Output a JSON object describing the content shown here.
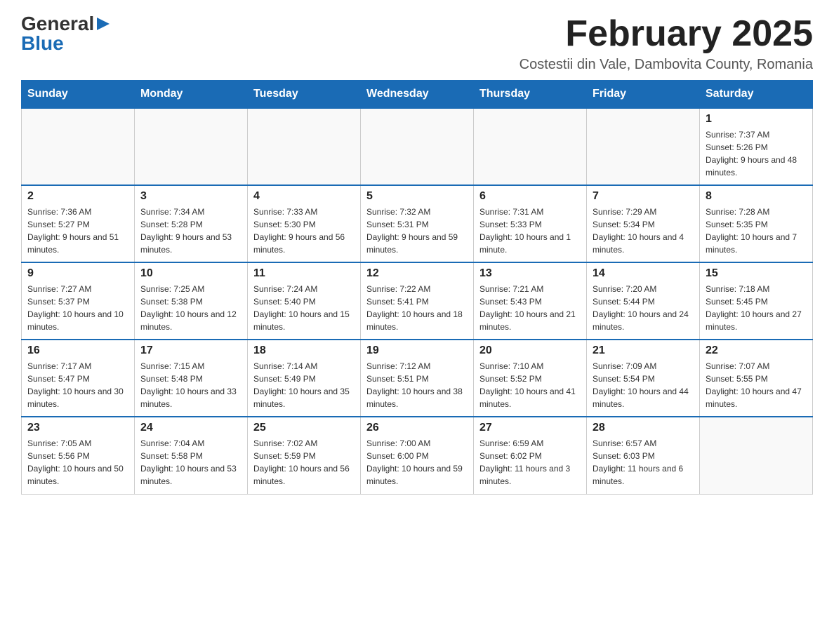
{
  "logo": {
    "general": "General",
    "blue": "Blue"
  },
  "header": {
    "title": "February 2025",
    "subtitle": "Costestii din Vale, Dambovita County, Romania"
  },
  "days_of_week": [
    "Sunday",
    "Monday",
    "Tuesday",
    "Wednesday",
    "Thursday",
    "Friday",
    "Saturday"
  ],
  "weeks": [
    [
      {
        "day": "",
        "info": ""
      },
      {
        "day": "",
        "info": ""
      },
      {
        "day": "",
        "info": ""
      },
      {
        "day": "",
        "info": ""
      },
      {
        "day": "",
        "info": ""
      },
      {
        "day": "",
        "info": ""
      },
      {
        "day": "1",
        "info": "Sunrise: 7:37 AM\nSunset: 5:26 PM\nDaylight: 9 hours and 48 minutes."
      }
    ],
    [
      {
        "day": "2",
        "info": "Sunrise: 7:36 AM\nSunset: 5:27 PM\nDaylight: 9 hours and 51 minutes."
      },
      {
        "day": "3",
        "info": "Sunrise: 7:34 AM\nSunset: 5:28 PM\nDaylight: 9 hours and 53 minutes."
      },
      {
        "day": "4",
        "info": "Sunrise: 7:33 AM\nSunset: 5:30 PM\nDaylight: 9 hours and 56 minutes."
      },
      {
        "day": "5",
        "info": "Sunrise: 7:32 AM\nSunset: 5:31 PM\nDaylight: 9 hours and 59 minutes."
      },
      {
        "day": "6",
        "info": "Sunrise: 7:31 AM\nSunset: 5:33 PM\nDaylight: 10 hours and 1 minute."
      },
      {
        "day": "7",
        "info": "Sunrise: 7:29 AM\nSunset: 5:34 PM\nDaylight: 10 hours and 4 minutes."
      },
      {
        "day": "8",
        "info": "Sunrise: 7:28 AM\nSunset: 5:35 PM\nDaylight: 10 hours and 7 minutes."
      }
    ],
    [
      {
        "day": "9",
        "info": "Sunrise: 7:27 AM\nSunset: 5:37 PM\nDaylight: 10 hours and 10 minutes."
      },
      {
        "day": "10",
        "info": "Sunrise: 7:25 AM\nSunset: 5:38 PM\nDaylight: 10 hours and 12 minutes."
      },
      {
        "day": "11",
        "info": "Sunrise: 7:24 AM\nSunset: 5:40 PM\nDaylight: 10 hours and 15 minutes."
      },
      {
        "day": "12",
        "info": "Sunrise: 7:22 AM\nSunset: 5:41 PM\nDaylight: 10 hours and 18 minutes."
      },
      {
        "day": "13",
        "info": "Sunrise: 7:21 AM\nSunset: 5:43 PM\nDaylight: 10 hours and 21 minutes."
      },
      {
        "day": "14",
        "info": "Sunrise: 7:20 AM\nSunset: 5:44 PM\nDaylight: 10 hours and 24 minutes."
      },
      {
        "day": "15",
        "info": "Sunrise: 7:18 AM\nSunset: 5:45 PM\nDaylight: 10 hours and 27 minutes."
      }
    ],
    [
      {
        "day": "16",
        "info": "Sunrise: 7:17 AM\nSunset: 5:47 PM\nDaylight: 10 hours and 30 minutes."
      },
      {
        "day": "17",
        "info": "Sunrise: 7:15 AM\nSunset: 5:48 PM\nDaylight: 10 hours and 33 minutes."
      },
      {
        "day": "18",
        "info": "Sunrise: 7:14 AM\nSunset: 5:49 PM\nDaylight: 10 hours and 35 minutes."
      },
      {
        "day": "19",
        "info": "Sunrise: 7:12 AM\nSunset: 5:51 PM\nDaylight: 10 hours and 38 minutes."
      },
      {
        "day": "20",
        "info": "Sunrise: 7:10 AM\nSunset: 5:52 PM\nDaylight: 10 hours and 41 minutes."
      },
      {
        "day": "21",
        "info": "Sunrise: 7:09 AM\nSunset: 5:54 PM\nDaylight: 10 hours and 44 minutes."
      },
      {
        "day": "22",
        "info": "Sunrise: 7:07 AM\nSunset: 5:55 PM\nDaylight: 10 hours and 47 minutes."
      }
    ],
    [
      {
        "day": "23",
        "info": "Sunrise: 7:05 AM\nSunset: 5:56 PM\nDaylight: 10 hours and 50 minutes."
      },
      {
        "day": "24",
        "info": "Sunrise: 7:04 AM\nSunset: 5:58 PM\nDaylight: 10 hours and 53 minutes."
      },
      {
        "day": "25",
        "info": "Sunrise: 7:02 AM\nSunset: 5:59 PM\nDaylight: 10 hours and 56 minutes."
      },
      {
        "day": "26",
        "info": "Sunrise: 7:00 AM\nSunset: 6:00 PM\nDaylight: 10 hours and 59 minutes."
      },
      {
        "day": "27",
        "info": "Sunrise: 6:59 AM\nSunset: 6:02 PM\nDaylight: 11 hours and 3 minutes."
      },
      {
        "day": "28",
        "info": "Sunrise: 6:57 AM\nSunset: 6:03 PM\nDaylight: 11 hours and 6 minutes."
      },
      {
        "day": "",
        "info": ""
      }
    ]
  ]
}
